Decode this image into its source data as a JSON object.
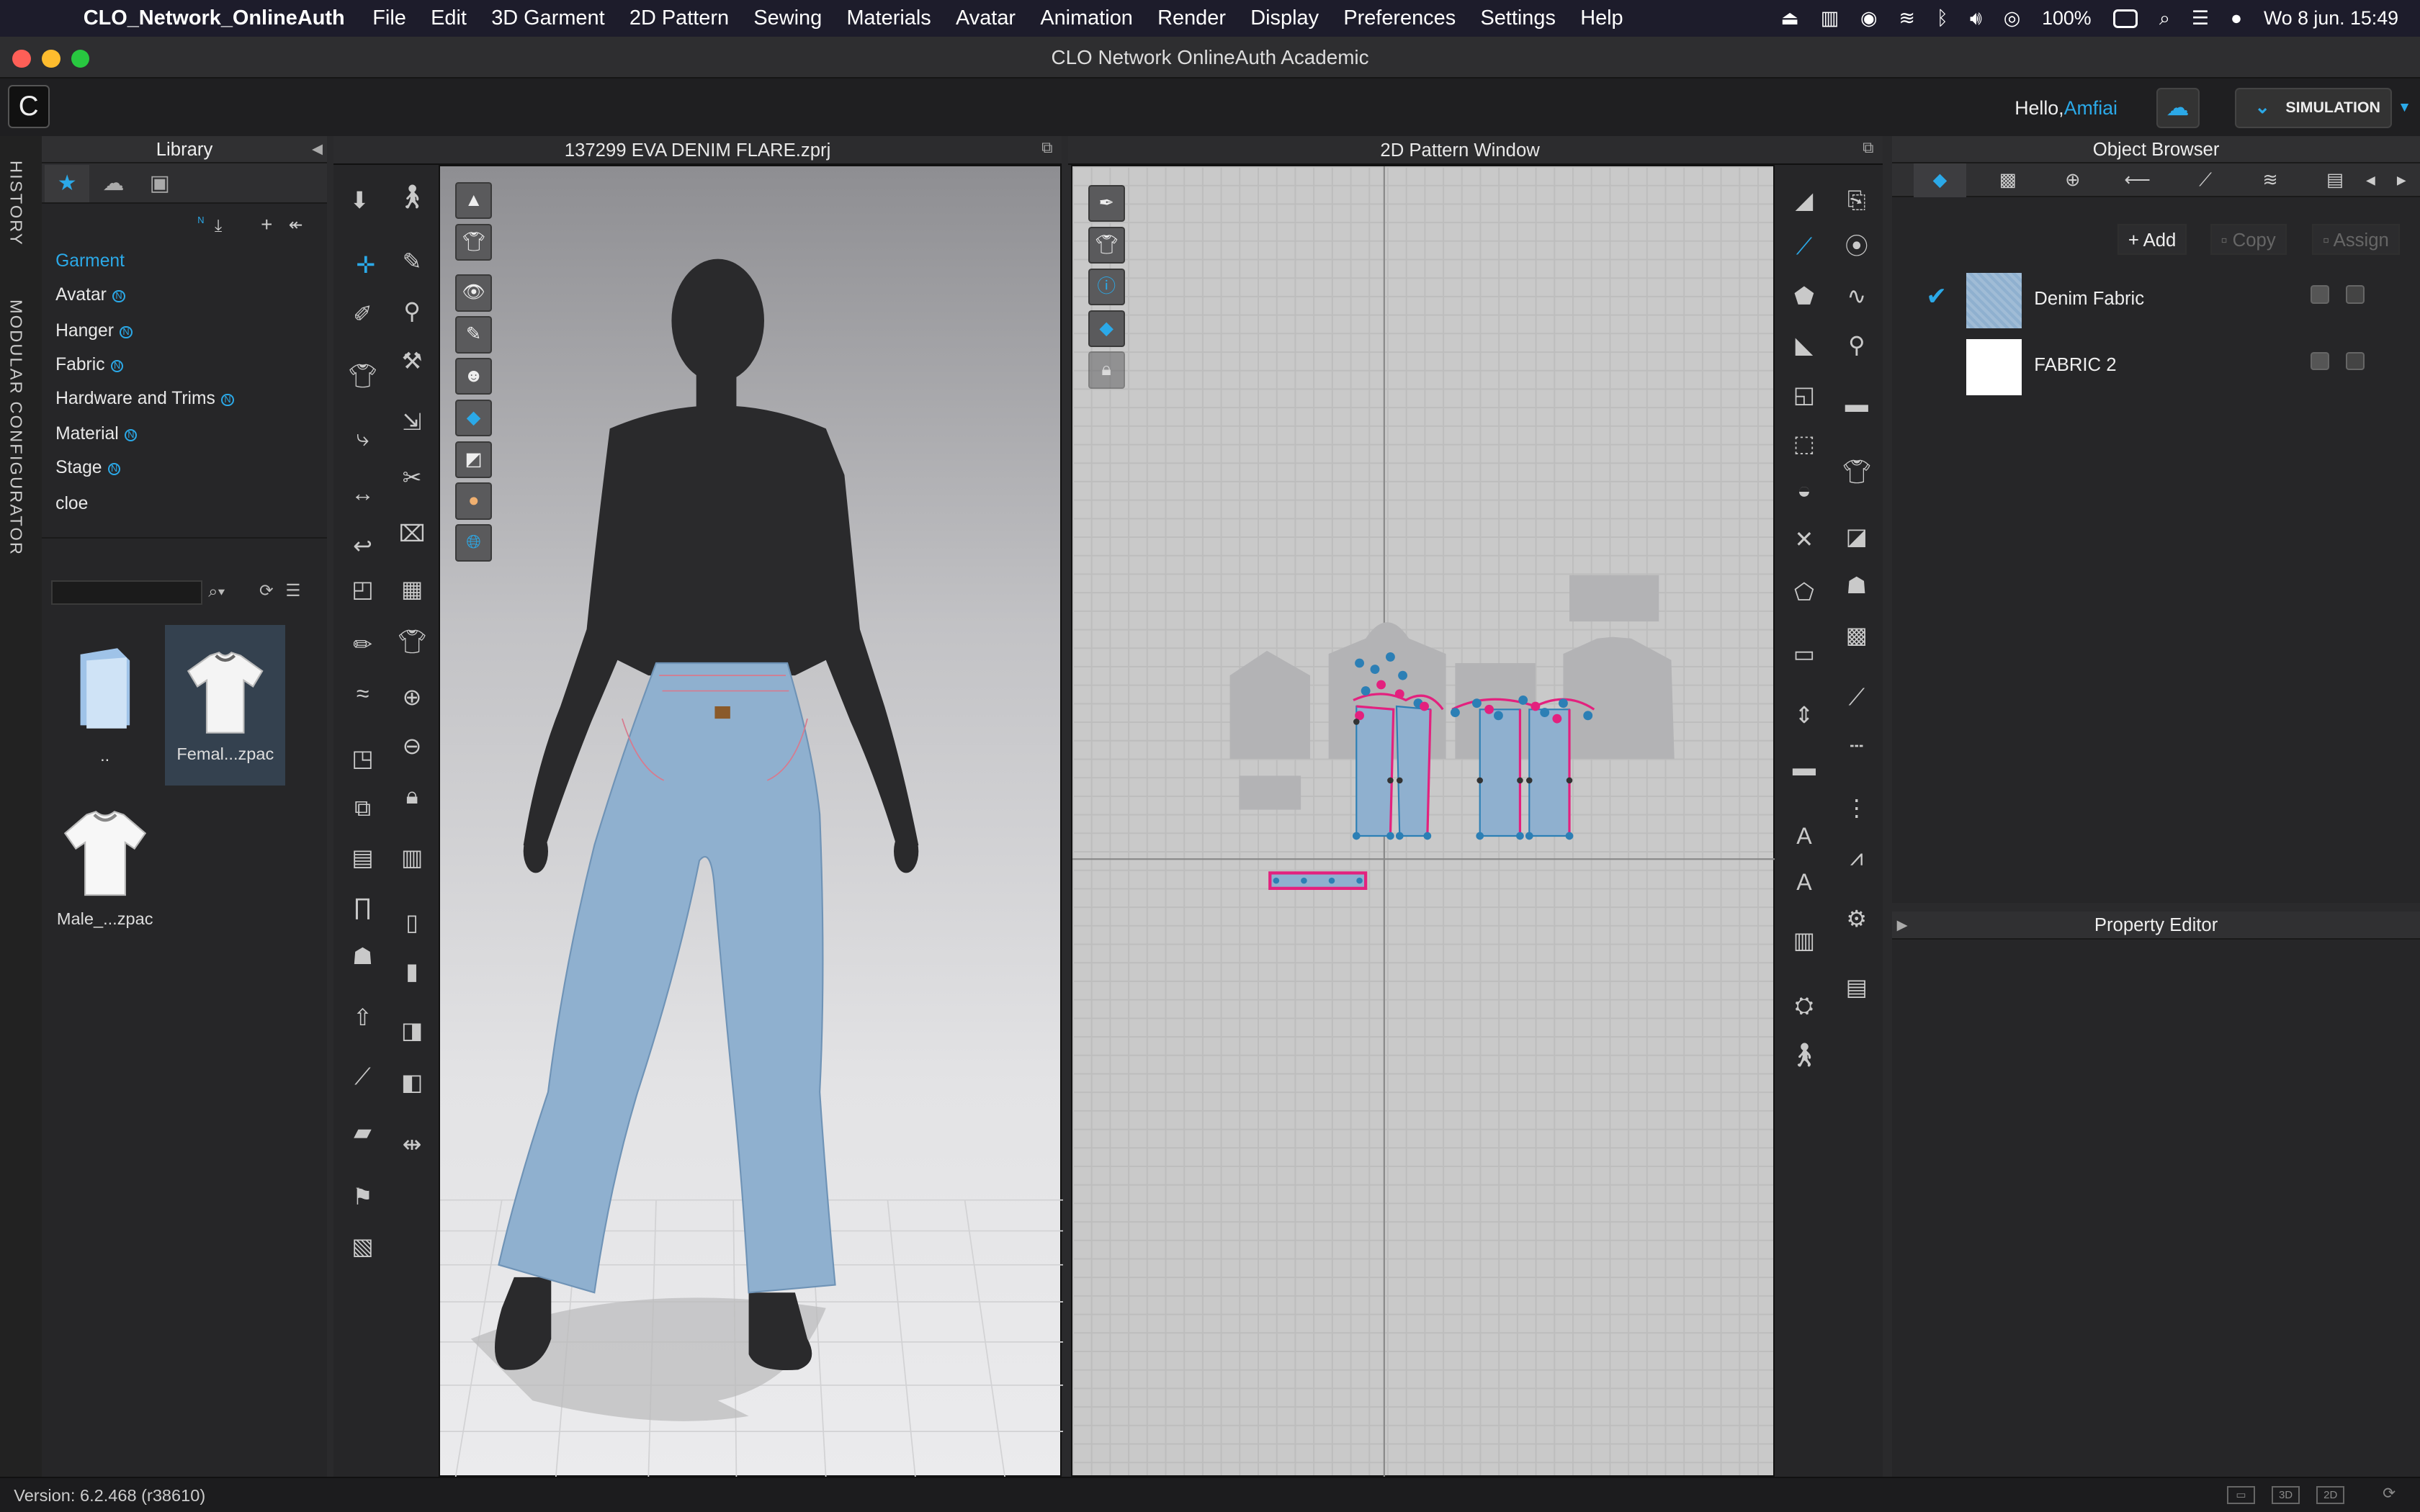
{
  "menubar": {
    "app_name": "CLO_Network_OnlineAuth",
    "items": [
      "File",
      "Edit",
      "3D Garment",
      "2D Pattern",
      "Sewing",
      "Materials",
      "Avatar",
      "Animation",
      "Render",
      "Display",
      "Preferences",
      "Settings",
      "Help"
    ],
    "battery": "100%",
    "clock": "Wo 8 jun.  15:49"
  },
  "window": {
    "title": "CLO Network OnlineAuth Academic"
  },
  "toolbar": {
    "hello_label": "Hello,",
    "user": "Amfiai",
    "mode_label": "SIMULATION"
  },
  "sidebar": {
    "tabs": [
      "HISTORY",
      "MODULAR CONFIGURATOR"
    ]
  },
  "library": {
    "title": "Library",
    "items": [
      {
        "label": "Garment",
        "selected": true,
        "badge": false
      },
      {
        "label": "Avatar",
        "badge": true
      },
      {
        "label": "Hanger",
        "badge": true
      },
      {
        "label": "Fabric",
        "badge": true
      },
      {
        "label": "Hardware and Trims",
        "badge": true
      },
      {
        "label": "Material",
        "badge": true
      },
      {
        "label": "Stage",
        "badge": true
      },
      {
        "label": "cloe",
        "badge": false
      }
    ],
    "search_value": "",
    "files": [
      {
        "label": "..",
        "icon": "folder-icon"
      },
      {
        "label": "Femal...zpac",
        "icon": "tshirt-icon",
        "selected": true
      },
      {
        "label": "Male_...zpac",
        "icon": "tshirt-icon"
      }
    ]
  },
  "viewport3d": {
    "title": "137299 EVA DENIM FLARE.zprj"
  },
  "pattern2d": {
    "title": "2D Pattern Window"
  },
  "object_browser": {
    "title": "Object Browser",
    "buttons": {
      "add": "Add",
      "copy": "Copy",
      "assign": "Assign"
    },
    "fabrics": [
      {
        "name": "Denim Fabric",
        "color": "#8fb0cf",
        "checked": true
      },
      {
        "name": "FABRIC 2",
        "color": "#ffffff",
        "checked": false
      }
    ]
  },
  "property_editor": {
    "title": "Property Editor"
  },
  "status": {
    "version": "Version: 6.2.468 (r38610)",
    "view_buttons": [
      "3D",
      "2D"
    ]
  },
  "colors": {
    "accent": "#2ba9e8",
    "pink": "#e3217e"
  }
}
